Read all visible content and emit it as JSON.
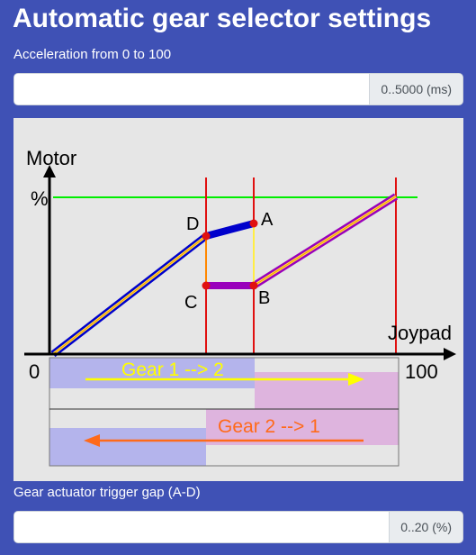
{
  "title": "Automatic gear selector settings",
  "acceleration": {
    "label": "Acceleration from 0 to 100",
    "value": "",
    "unit": "0..5000 (ms)"
  },
  "diagram": {
    "y_axis_label": "Motor",
    "y_axis_unit": "%",
    "x_axis_label": "Joypad",
    "x_min": "0",
    "x_max": "100",
    "points": {
      "a": "A",
      "b": "B",
      "c": "C",
      "d": "D"
    },
    "upshift_label": "Gear 1 --> 2",
    "downshift_label": "Gear 2 --> 1",
    "colors": {
      "gear1_fill": "#b4b4ec",
      "gear2_fill": "#deb4de",
      "gear1_line": "#0000cc",
      "gear2_line": "#9900bb",
      "threshold": "#e01010",
      "max_line": "#00ee00",
      "upshift_arrow": "#ffff00",
      "downshift_arrow": "#ff6a1a"
    }
  },
  "trigger_gap": {
    "label": "Gear actuator trigger gap (A-D)",
    "value": "",
    "unit": "0..20 (%)"
  }
}
